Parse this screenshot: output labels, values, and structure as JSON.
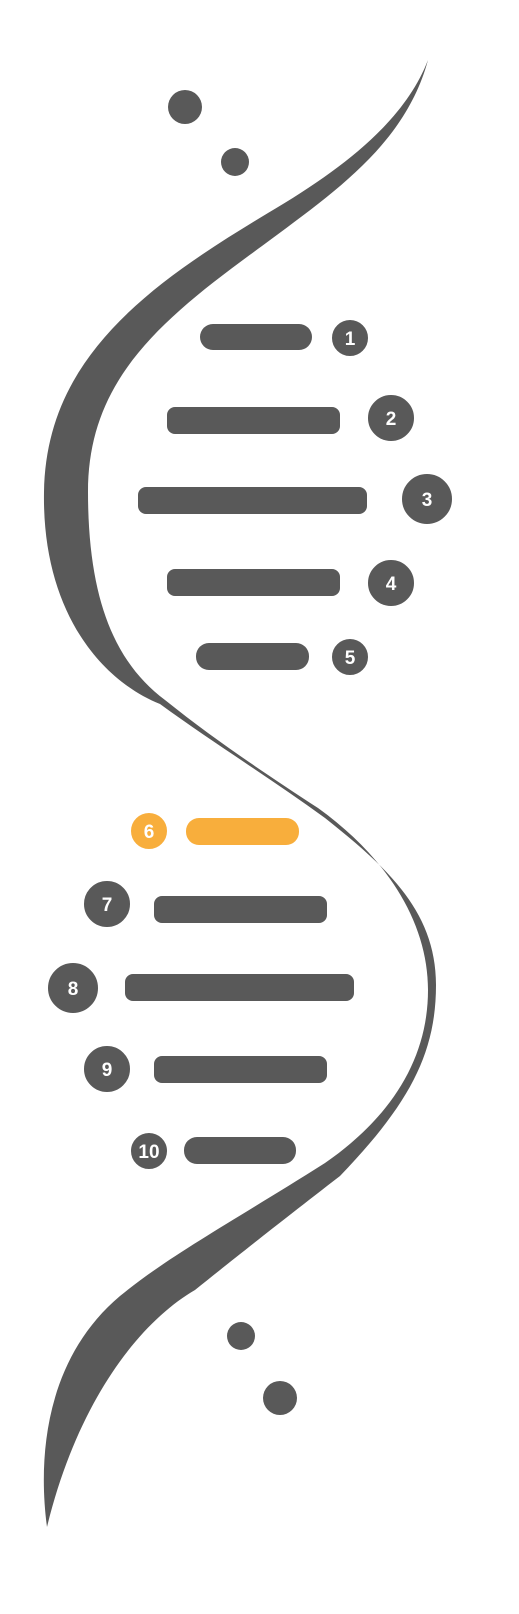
{
  "colors": {
    "primary": "#595959",
    "highlight": "#F8AE3C",
    "background": "#FFFFFF",
    "badge_text": "#FFFFFF"
  },
  "steps": [
    {
      "number": "1",
      "highlighted": false
    },
    {
      "number": "2",
      "highlighted": false
    },
    {
      "number": "3",
      "highlighted": false
    },
    {
      "number": "4",
      "highlighted": false
    },
    {
      "number": "5",
      "highlighted": false
    },
    {
      "number": "6",
      "highlighted": true
    },
    {
      "number": "7",
      "highlighted": false
    },
    {
      "number": "8",
      "highlighted": false
    },
    {
      "number": "9",
      "highlighted": false
    },
    {
      "number": "10",
      "highlighted": false
    }
  ]
}
